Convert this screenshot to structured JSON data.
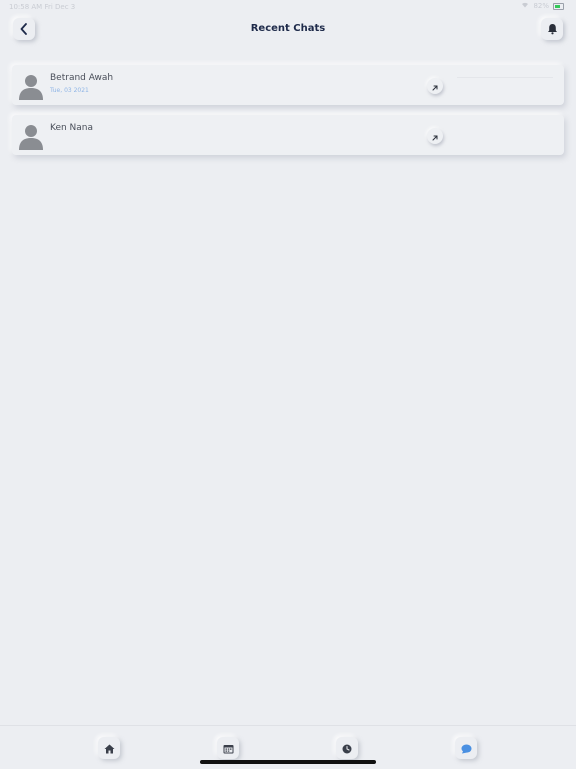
{
  "status_bar": {
    "time": "10:58 AM  Fri Dec 3",
    "battery": "82%"
  },
  "header": {
    "title": "Recent Chats"
  },
  "chats": [
    {
      "name": "Betrand Awah",
      "date": "Tue, 03 2021"
    },
    {
      "name": "Ken Nana",
      "date": ""
    }
  ],
  "tabs": [
    {
      "icon": "home-icon"
    },
    {
      "icon": "calendar-icon"
    },
    {
      "icon": "clock-icon"
    },
    {
      "icon": "chat-bubble-icon"
    }
  ],
  "colors": {
    "background": "#eceef2",
    "title": "#1e2a4a",
    "date_accent": "#8fb5e6",
    "active_tab": "#4a90e2"
  }
}
